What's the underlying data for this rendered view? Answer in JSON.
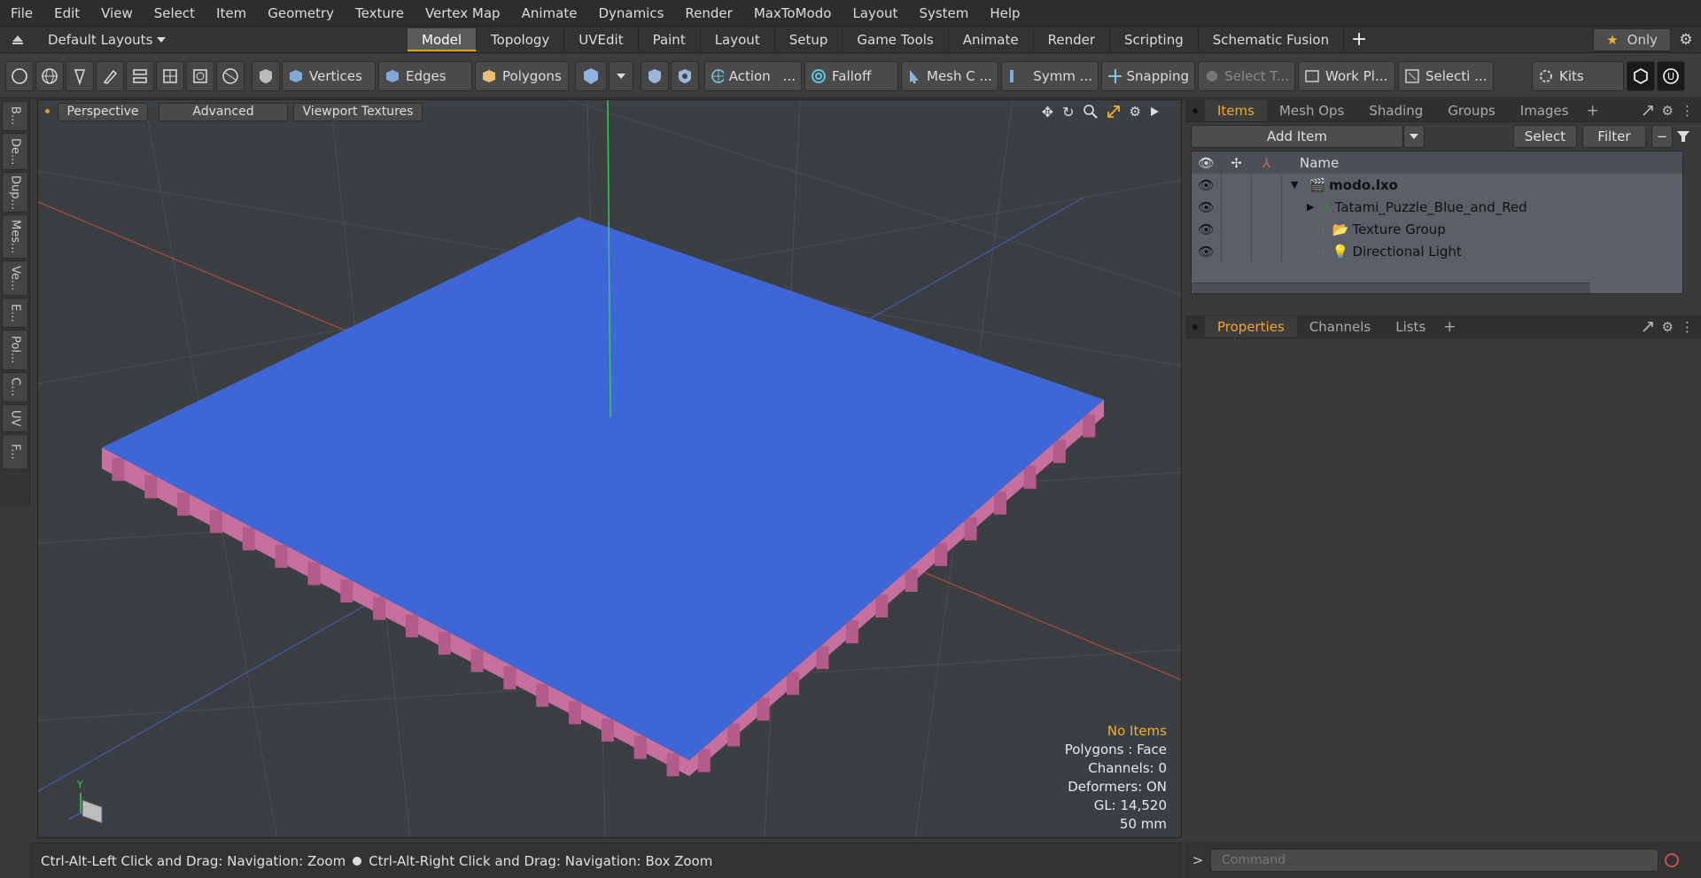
{
  "menu": [
    "File",
    "Edit",
    "View",
    "Select",
    "Item",
    "Geometry",
    "Texture",
    "Vertex Map",
    "Animate",
    "Dynamics",
    "Render",
    "MaxToModo",
    "Layout",
    "System",
    "Help"
  ],
  "layout_bar": {
    "preset": "Default Layouts",
    "tabs": [
      "Model",
      "Topology",
      "UVEdit",
      "Paint",
      "Layout",
      "Setup",
      "Game Tools",
      "Animate",
      "Render",
      "Scripting",
      "Schematic Fusion"
    ],
    "active_tab": "Model",
    "only_label": "Only"
  },
  "toolbar": {
    "vertices": "Vertices",
    "edges": "Edges",
    "polygons": "Polygons",
    "action": "Action",
    "action_more": "...",
    "falloff": "Falloff",
    "mesh": "Mesh C ...",
    "symmetry": "Symm ...",
    "snapping": "Snapping",
    "select_t": "Select T...",
    "work_plane": "Work Pl...",
    "selection": "Selecti ...",
    "kits": "Kits"
  },
  "left_tabs": [
    "B...",
    "De...",
    "Dup...",
    "Mes...",
    "Ve...",
    "E...",
    "Pol...",
    "C...",
    "UV",
    "F..."
  ],
  "viewport": {
    "view_mode": "Perspective",
    "shading": "Advanced",
    "textures": "Viewport Textures",
    "info": {
      "selection": "No Items",
      "polygons": "Polygons : Face",
      "channels": "Channels: 0",
      "deformers": "Deformers: ON",
      "gl": "GL: 14,520",
      "scale": "50 mm"
    },
    "axis_label": "Y"
  },
  "status": {
    "hint1": "Ctrl-Alt-Left Click and Drag: Navigation: Zoom",
    "hint2": "Ctrl-Alt-Right Click and Drag: Navigation: Box Zoom"
  },
  "items_panel": {
    "tabs": [
      "Items",
      "Mesh Ops",
      "Shading",
      "Groups",
      "Images"
    ],
    "active_tab": "Items",
    "add_item": "Add Item",
    "select": "Select",
    "filter": "Filter",
    "name_header": "Name",
    "rows": [
      {
        "name": "modo.lxo",
        "indent": 0,
        "bold": true,
        "icon": "scene-icon"
      },
      {
        "name": "Tatami_Puzzle_Blue_and_Red",
        "indent": 1,
        "bold": false,
        "icon": "mesh-icon"
      },
      {
        "name": "Texture Group",
        "indent": 1,
        "bold": false,
        "icon": "folder-icon"
      },
      {
        "name": "Directional Light",
        "indent": 1,
        "bold": false,
        "icon": "light-icon"
      }
    ]
  },
  "properties_panel": {
    "tabs": [
      "Properties",
      "Channels",
      "Lists"
    ],
    "active_tab": "Properties"
  },
  "command": {
    "placeholder": "Command"
  },
  "colors": {
    "accent": "#f0a830",
    "mesh_top": "#3f66d6",
    "mesh_side": "#c06a9a"
  }
}
